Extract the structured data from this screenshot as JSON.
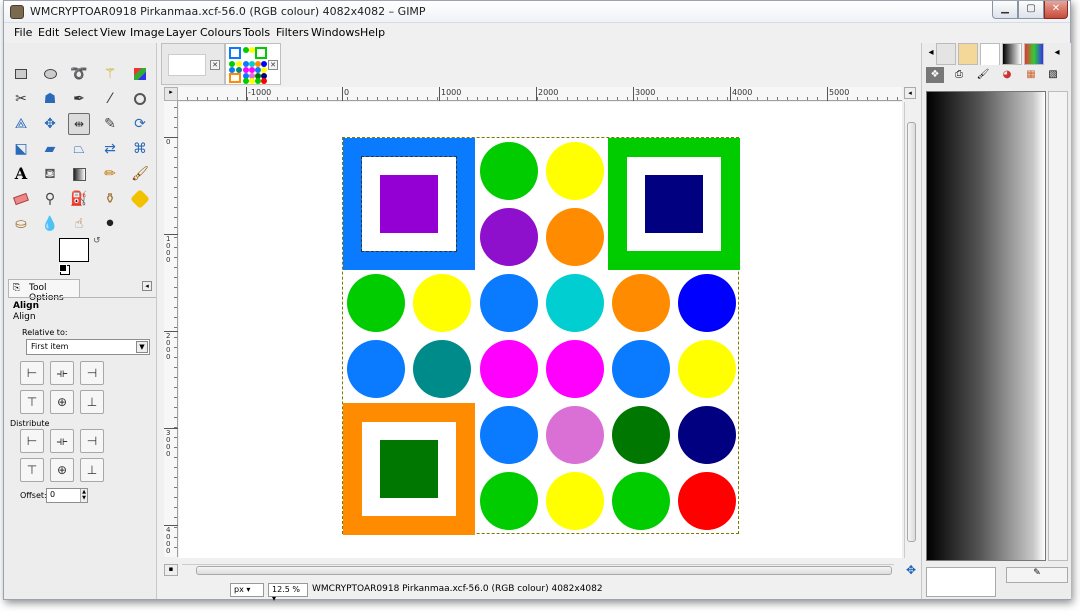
{
  "window": {
    "title": "WMCRYPTOAR0918 Pirkanmaa.xcf-56.0 (RGB colour) 4082x4082 – GIMP",
    "minimize": "▁",
    "maximize": "▢",
    "close": "✕"
  },
  "menubar": {
    "items": [
      "File",
      "Edit",
      "Select",
      "View",
      "Image",
      "Layer",
      "Colours",
      "Tools",
      "Filters",
      "Windows",
      "Help"
    ]
  },
  "toolbox": {
    "tools": [
      "rect-select-icon",
      "ellipse-select-icon",
      "free-select-icon",
      "fuzzy-select-icon",
      "select-by-color-icon",
      "scissors-select-icon",
      "foreground-select-icon",
      "paths-icon",
      "color-picker-icon",
      "zoom-icon",
      "measure-icon",
      "move-icon",
      "align-icon",
      "crop-icon",
      "rotate-icon",
      "scale-icon",
      "shear-icon",
      "perspective-icon",
      "flip-icon",
      "cage-transform-icon",
      "text-icon",
      "bucket-fill-icon",
      "blend-icon",
      "pencil-icon",
      "paintbrush-icon",
      "eraser-icon",
      "airbrush-icon",
      "ink-icon",
      "heal-icon",
      "clone-icon",
      "perspective-clone-icon",
      "blur-icon",
      "smudge-icon",
      "dodge-burn-icon"
    ],
    "active_tool": "align-icon"
  },
  "tool_options": {
    "tab_label": "Tool Options",
    "title": "Align",
    "section": "Align",
    "relative_to_label": "Relative to:",
    "relative_to_value": "First item",
    "distribute_label": "Distribute",
    "offset_label": "Offset:",
    "offset_value": "0"
  },
  "statusbar": {
    "unit": "px",
    "zoom": "12.5 %",
    "text": "WMCRYPTOAR0918 Pirkanmaa.xcf-56.0 (RGB colour) 4082x4082"
  },
  "ruler": {
    "h_labels": [
      "-1000",
      "0",
      "1000",
      "2000",
      "3000",
      "4000",
      "5000"
    ],
    "v_labels": [
      "0",
      "1000",
      "2000",
      "3000",
      "4000"
    ]
  },
  "colors": {
    "blue": "#0a7aff",
    "purple": "#9400d3",
    "green": "#00cc00",
    "navy": "#000080",
    "yellow": "#ffff00",
    "violet": "#8e0fcc",
    "orange": "#ff8c00",
    "cyan": "#00ced1",
    "teal": "#008b8b",
    "magenta": "#ff00ff",
    "orchid": "#da70d6",
    "darkgreen": "#007700",
    "red": "#ff0000",
    "royalblue": "#0000ff"
  }
}
